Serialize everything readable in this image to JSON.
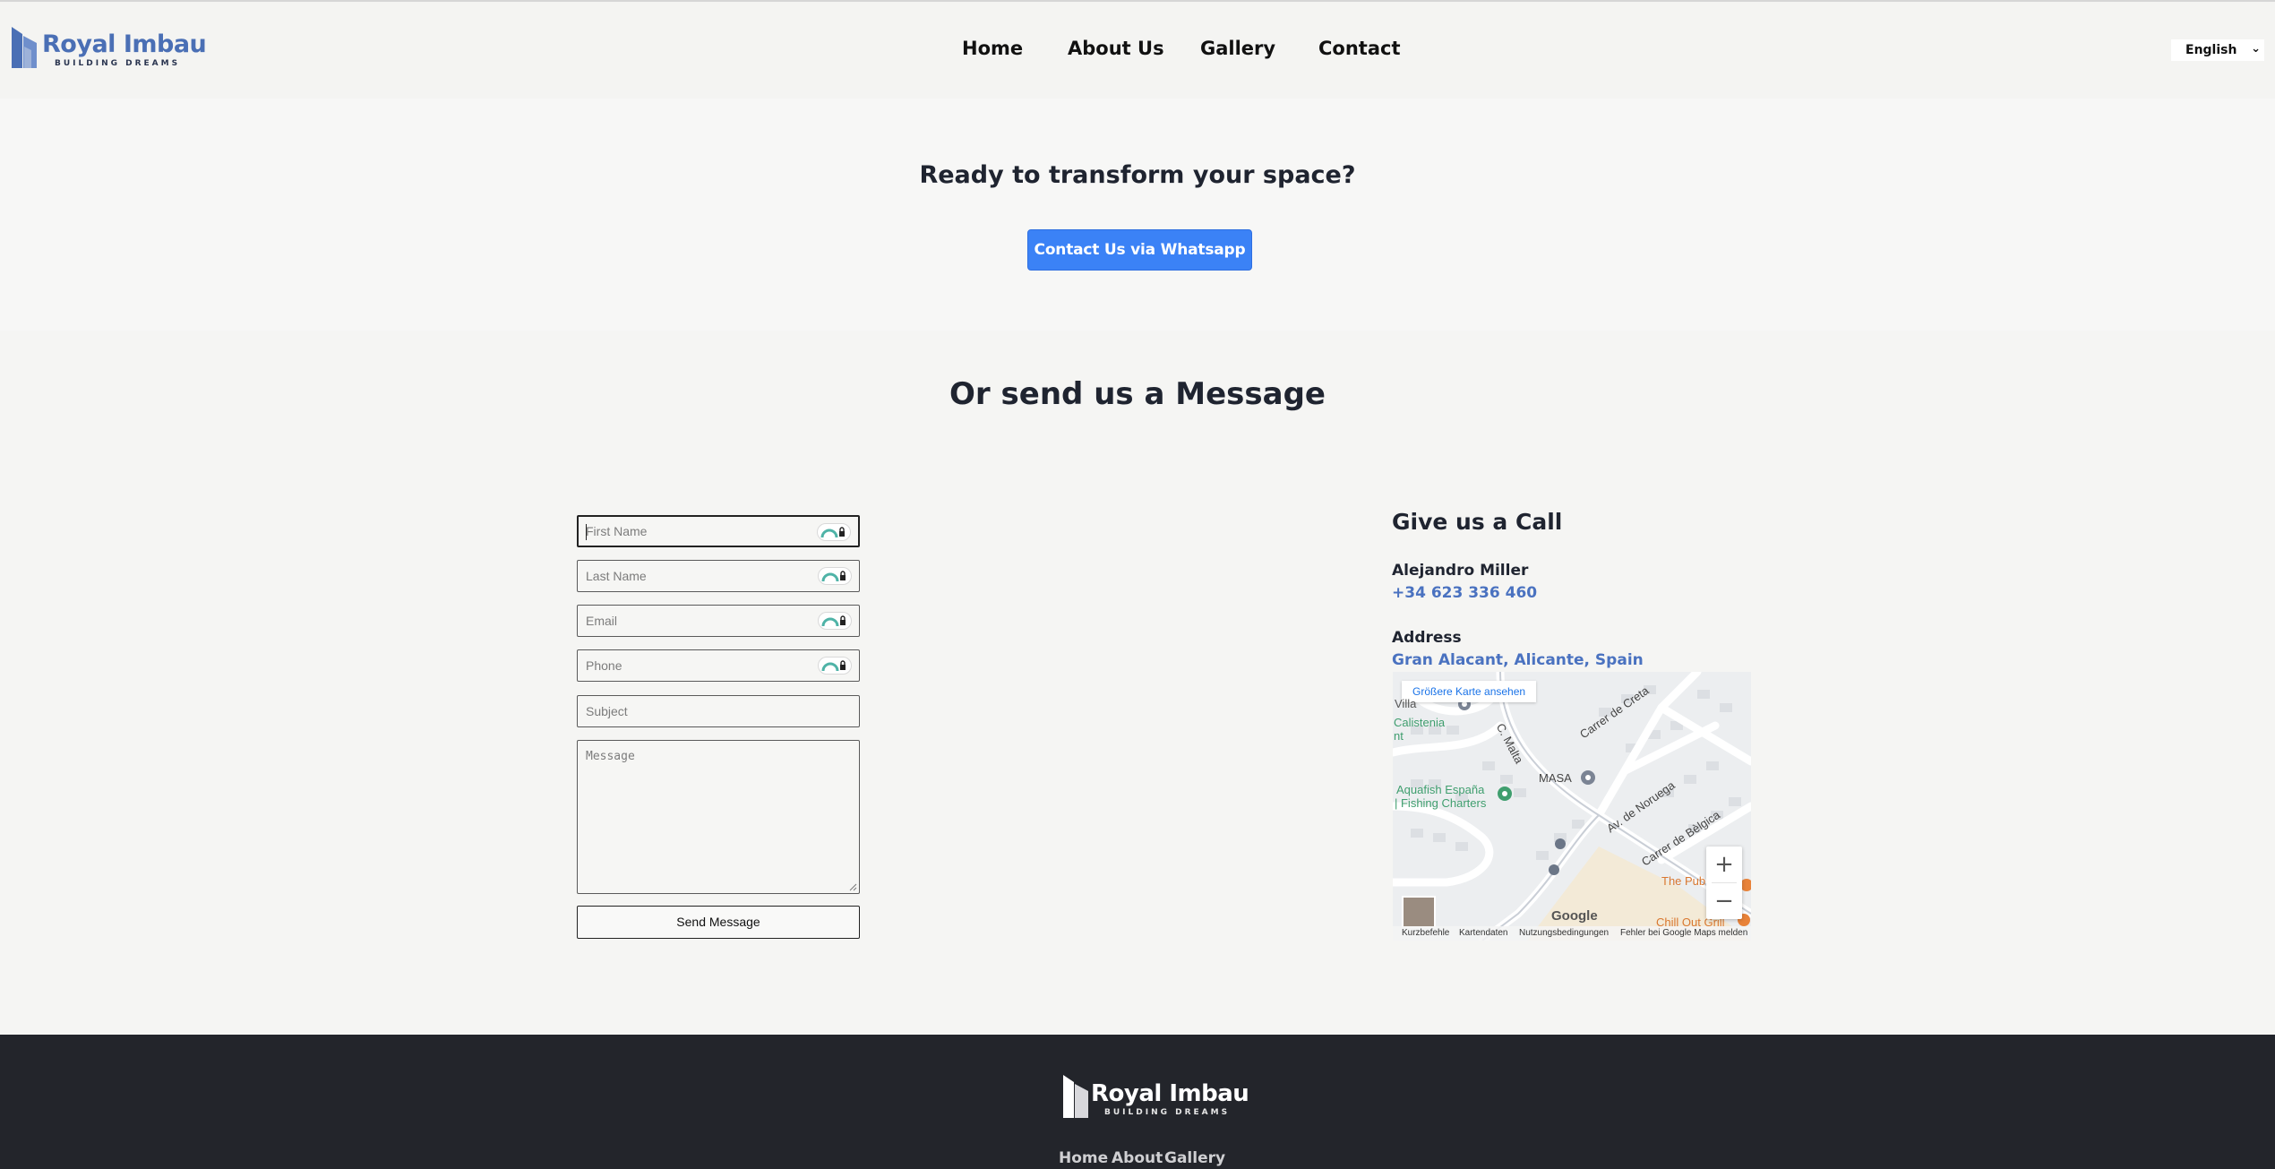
{
  "brand": {
    "name": "Royal Imbau",
    "tagline": "BUILDING DREAMS",
    "color": "#4a6fb5"
  },
  "nav": {
    "items": [
      "Home",
      "About Us",
      "Gallery",
      "Contact"
    ]
  },
  "language": {
    "selected": "English"
  },
  "hero": {
    "title": "Ready to transform your space?",
    "button_label": "Contact Us via Whatsapp",
    "button_color": "#3b82f6"
  },
  "form": {
    "title": "Or send us a Message",
    "first_name_placeholder": "First Name",
    "last_name_placeholder": "Last Name",
    "email_placeholder": "Email",
    "phone_placeholder": "Phone",
    "subject_placeholder": "Subject",
    "message_placeholder": "Message",
    "send_label": "Send Message"
  },
  "contact": {
    "call_title": "Give us a Call",
    "person": "Alejandro Miller",
    "phone": "+34 623 336 460",
    "address_label": "Address",
    "address": "Gran Alacant, Alicante, Spain",
    "link_color": "#4a72c0"
  },
  "map": {
    "larger_map_label": "Größere Karte ansehen",
    "labels": {
      "villa": "Villa",
      "calistenia": "Calistenia",
      "nt": "nt",
      "malta": "C. Malta",
      "creta": "Carrer de Creta",
      "aquafish1": "Aquafish España",
      "aquafish2": "| Fishing Charters",
      "masa": "MASA",
      "noruega": "Av. de Noruega",
      "belgica": "Carrer de Bèlgica",
      "pub": "The Pub",
      "chill": "Chill Out Grill"
    },
    "google": "Google",
    "attribution": [
      "Kurzbefehle",
      "Kartendaten",
      "Nutzungsbedingungen",
      "Fehler bei Google Maps melden"
    ]
  },
  "footer": {
    "nav": [
      "Home",
      "About",
      "Gallery"
    ]
  }
}
